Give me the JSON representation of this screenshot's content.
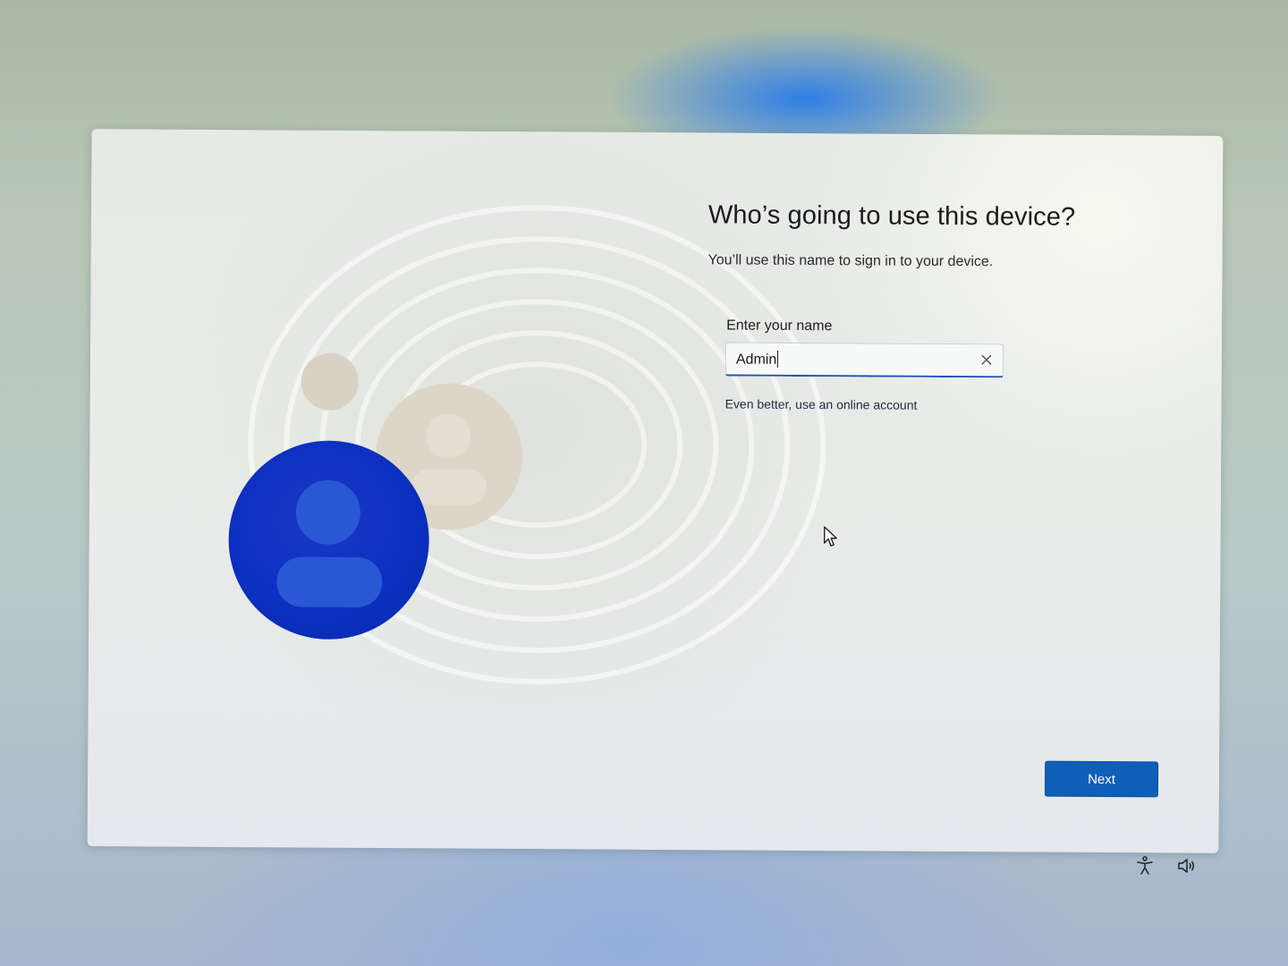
{
  "oobe": {
    "title": "Who’s going to use this device?",
    "subtitle": "You’ll use this name to sign in to your device.",
    "name_label": "Enter your name",
    "name_value": "Admin",
    "online_link": "Even better, use an online account",
    "next_label": "Next"
  },
  "icons": {
    "clear": "close-icon",
    "accessibility": "accessibility-icon",
    "volume": "volume-icon",
    "cursor": "mouse-pointer-icon",
    "avatar": "user-avatar-icon"
  },
  "colors": {
    "accent": "#0f5fb8",
    "avatar_main": "#0b2fbf",
    "avatar_ghost": "#ddd6c8"
  }
}
